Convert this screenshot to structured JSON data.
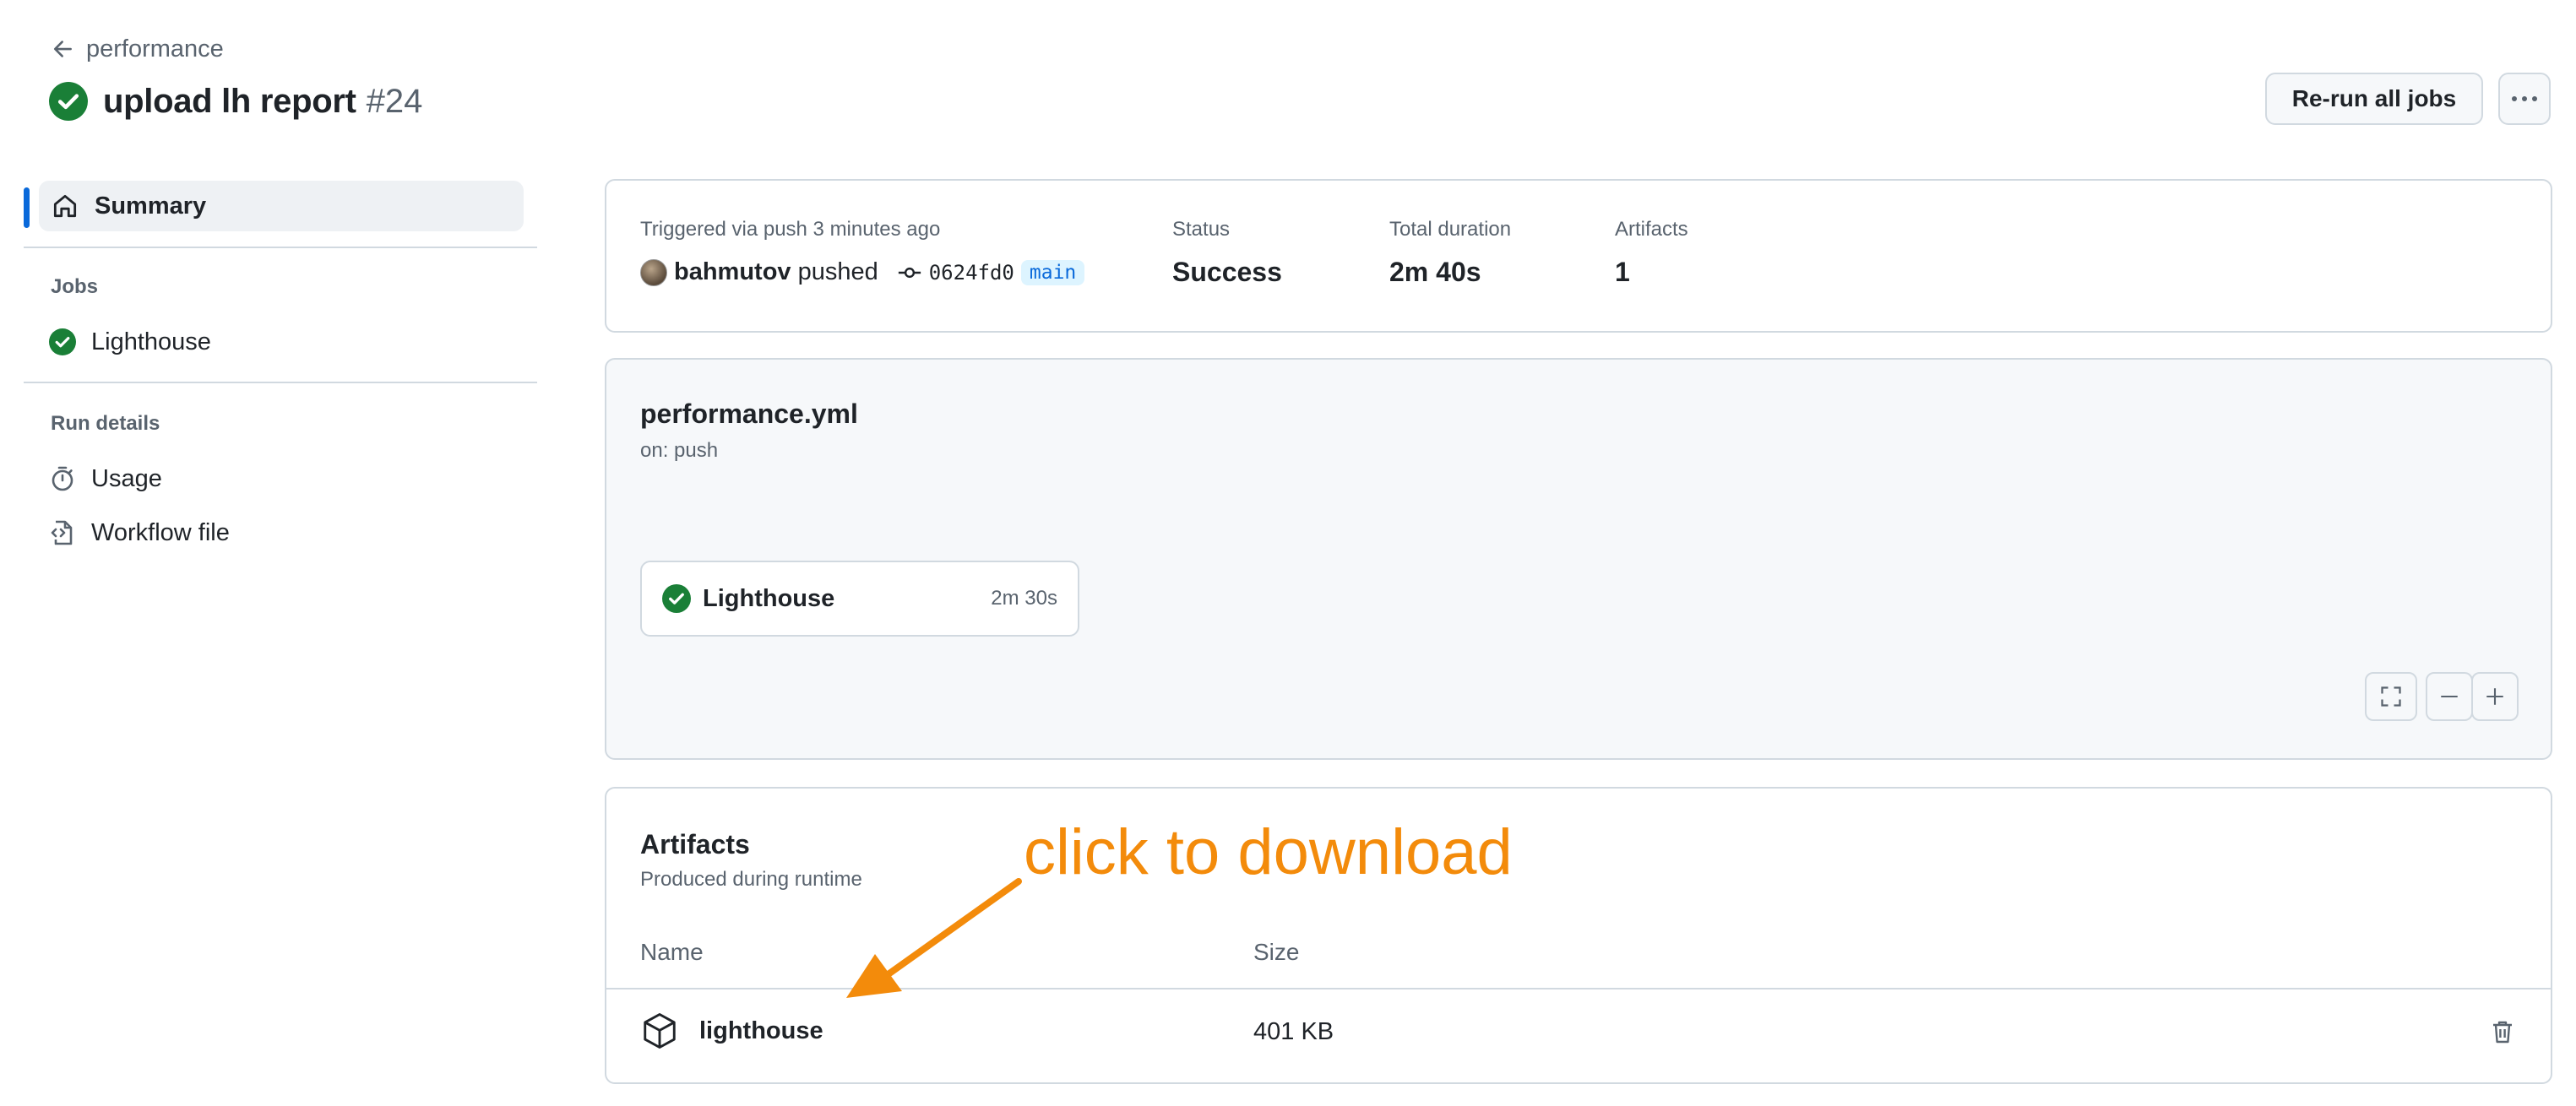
{
  "header": {
    "back_label": "performance",
    "title": "upload lh report",
    "run_number": "#24",
    "rerun_button": "Re-run all jobs",
    "more_button_icon": "kebab-horizontal-icon"
  },
  "sidebar": {
    "summary_label": "Summary",
    "jobs_heading": "Jobs",
    "jobs": [
      {
        "label": "Lighthouse",
        "status": "success"
      }
    ],
    "run_details_heading": "Run details",
    "details": [
      {
        "label": "Usage",
        "icon": "stopwatch-icon"
      },
      {
        "label": "Workflow file",
        "icon": "file-code-icon"
      }
    ]
  },
  "summary_card": {
    "trigger_text": "Triggered via push 3 minutes ago",
    "actor": "bahmutov",
    "action": "pushed",
    "commit_sha": "0624fd0",
    "branch": "main",
    "status_label": "Status",
    "status_value": "Success",
    "duration_label": "Total duration",
    "duration_value": "2m 40s",
    "artifacts_label": "Artifacts",
    "artifacts_value": "1"
  },
  "workflow_card": {
    "file_name": "performance.yml",
    "trigger": "on: push",
    "job_name": "Lighthouse",
    "job_duration": "2m 30s"
  },
  "artifacts_card": {
    "title": "Artifacts",
    "subtitle": "Produced during runtime",
    "col_name": "Name",
    "col_size": "Size",
    "rows": [
      {
        "name": "lighthouse",
        "size": "401 KB"
      }
    ]
  },
  "annotation": {
    "text": "click to download",
    "color": "#f38b0b"
  },
  "colors": {
    "success": "#1a7f37",
    "accent": "#0969da",
    "border": "#d1d9e0",
    "muted": "#59636e"
  }
}
